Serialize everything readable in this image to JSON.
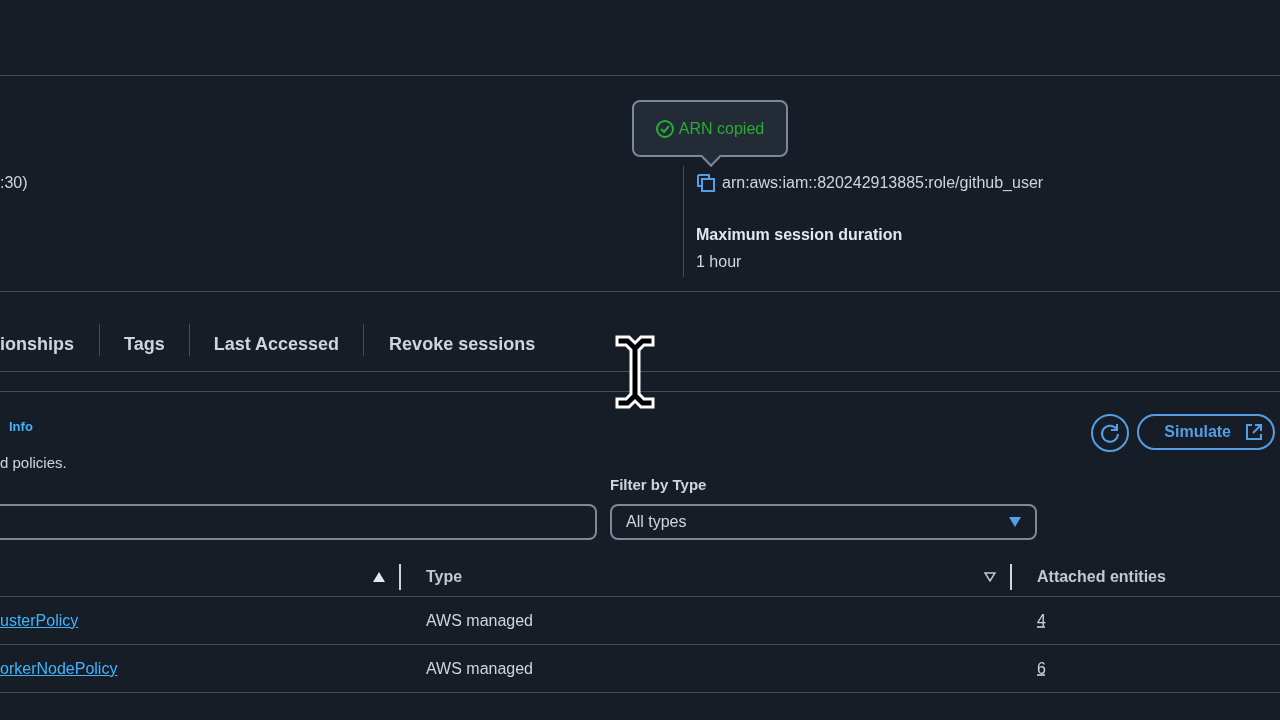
{
  "summary": {
    "left_value": ":30)",
    "arn": "arn:aws:iam::820242913885:role/github_user",
    "max_session_label": "Maximum session duration",
    "max_session_value": "1 hour"
  },
  "toast": {
    "text": "ARN copied"
  },
  "tabs": [
    {
      "label": "ionships",
      "selected": false
    },
    {
      "label": "Tags",
      "selected": false
    },
    {
      "label": "Last Accessed",
      "selected": false
    },
    {
      "label": "Revoke sessions",
      "selected": false
    }
  ],
  "permissions": {
    "info": "Info",
    "description": "d policies.",
    "simulate": "Simulate",
    "filter_label": "Filter by Type",
    "filter_value": "All types"
  },
  "table": {
    "columns": [
      {
        "sorted": true
      },
      {
        "label": "Type",
        "sorted": false
      },
      {
        "label": "Attached entities"
      }
    ],
    "rows": [
      {
        "name": "usterPolicy",
        "type": "AWS managed",
        "entities": "4"
      },
      {
        "name": "orkerNodePolicy",
        "type": "AWS managed",
        "entities": "6"
      }
    ]
  }
}
